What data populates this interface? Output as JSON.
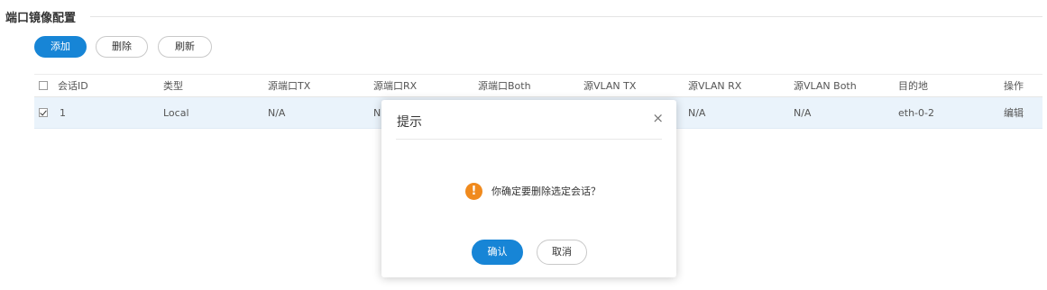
{
  "section": {
    "title": "端口镜像配置"
  },
  "toolbar": {
    "add_label": "添加",
    "delete_label": "删除",
    "refresh_label": "刷新"
  },
  "table": {
    "headers": [
      "会话ID",
      "类型",
      "源端口TX",
      "源端口RX",
      "源端口Both",
      "源VLAN TX",
      "源VLAN RX",
      "源VLAN Both",
      "目的地",
      "操作"
    ],
    "rows": [
      {
        "checked": true,
        "cells": [
          "1",
          "Local",
          "N/A",
          "N",
          "",
          "",
          "N/A",
          "N/A",
          "eth-0-2",
          "编辑"
        ]
      }
    ]
  },
  "dialog": {
    "title": "提示",
    "close_glyph": "×",
    "icon": "warning-icon",
    "icon_glyph": "!",
    "message": "你确定要删除选定会话？",
    "ok_label": "确认",
    "cancel_label": "取消"
  },
  "colors": {
    "primary": "#1785d6",
    "row_selected": "#eaf3fb",
    "warning": "#f08a1d"
  }
}
